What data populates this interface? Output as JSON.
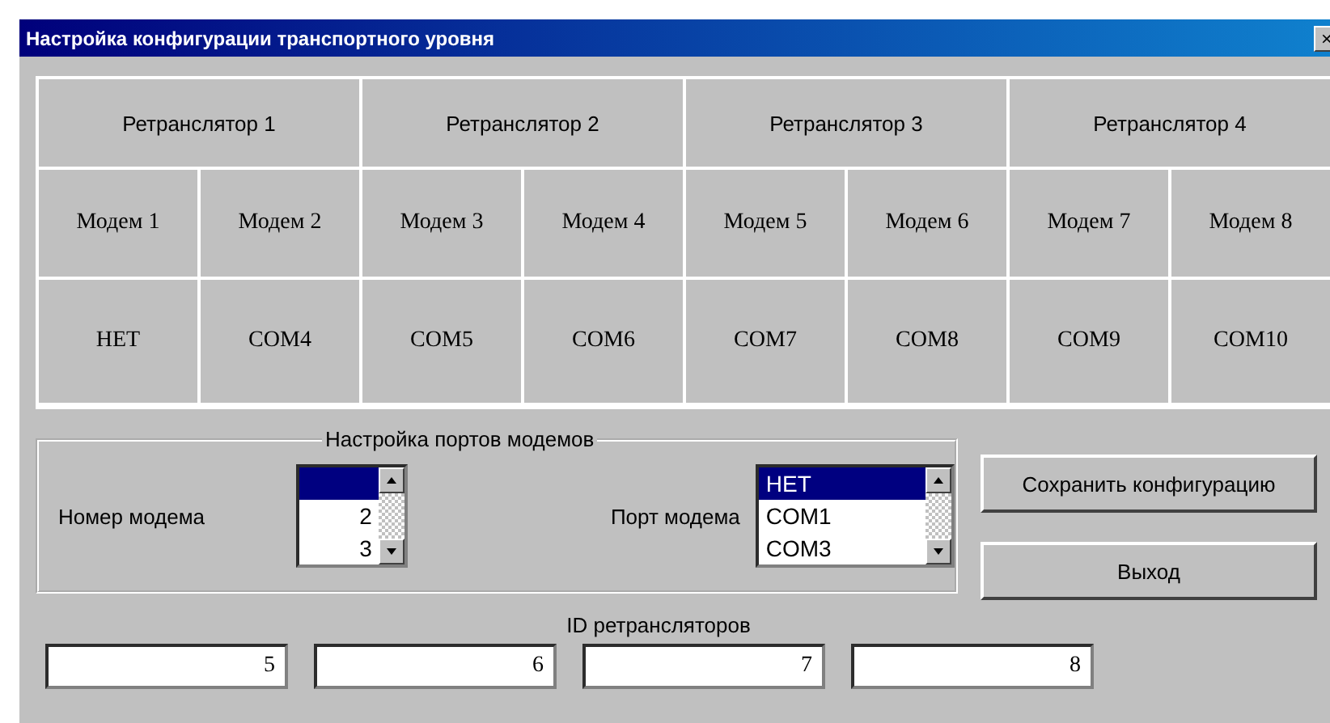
{
  "window": {
    "title": "Настройка конфигурации транспортного уровня",
    "close": "×"
  },
  "table": {
    "relays": [
      "Ретранслятор 1",
      "Ретранслятор 2",
      "Ретранслятор 3",
      "Ретранслятор 4"
    ],
    "modems": [
      "Модем 1",
      "Модем 2",
      "Модем 3",
      "Модем 4",
      "Модем 5",
      "Модем 6",
      "Модем 7",
      "Модем 8"
    ],
    "ports": [
      "НЕТ",
      "COM4",
      "COM5",
      "COM6",
      "COM7",
      "COM8",
      "COM9",
      "COM10"
    ]
  },
  "port_settings": {
    "title": "Настройка портов модемов",
    "modem_label": "Номер модема",
    "modem_list": [
      {
        "selected": true
      },
      {
        "text": "2",
        "selected": false
      },
      {
        "text": "3",
        "selected": false
      }
    ],
    "port_label": "Порт модема",
    "port_list": [
      {
        "text": "НЕТ",
        "selected": true
      },
      {
        "text": "COM1",
        "selected": false
      },
      {
        "text": "COM3",
        "selected": false
      }
    ]
  },
  "buttons": [
    "Сохранить конфигурацию",
    "Выход"
  ],
  "relay_ids": {
    "label": "ID ретрансляторов",
    "values": [
      "5",
      "6",
      "7",
      "8"
    ]
  }
}
